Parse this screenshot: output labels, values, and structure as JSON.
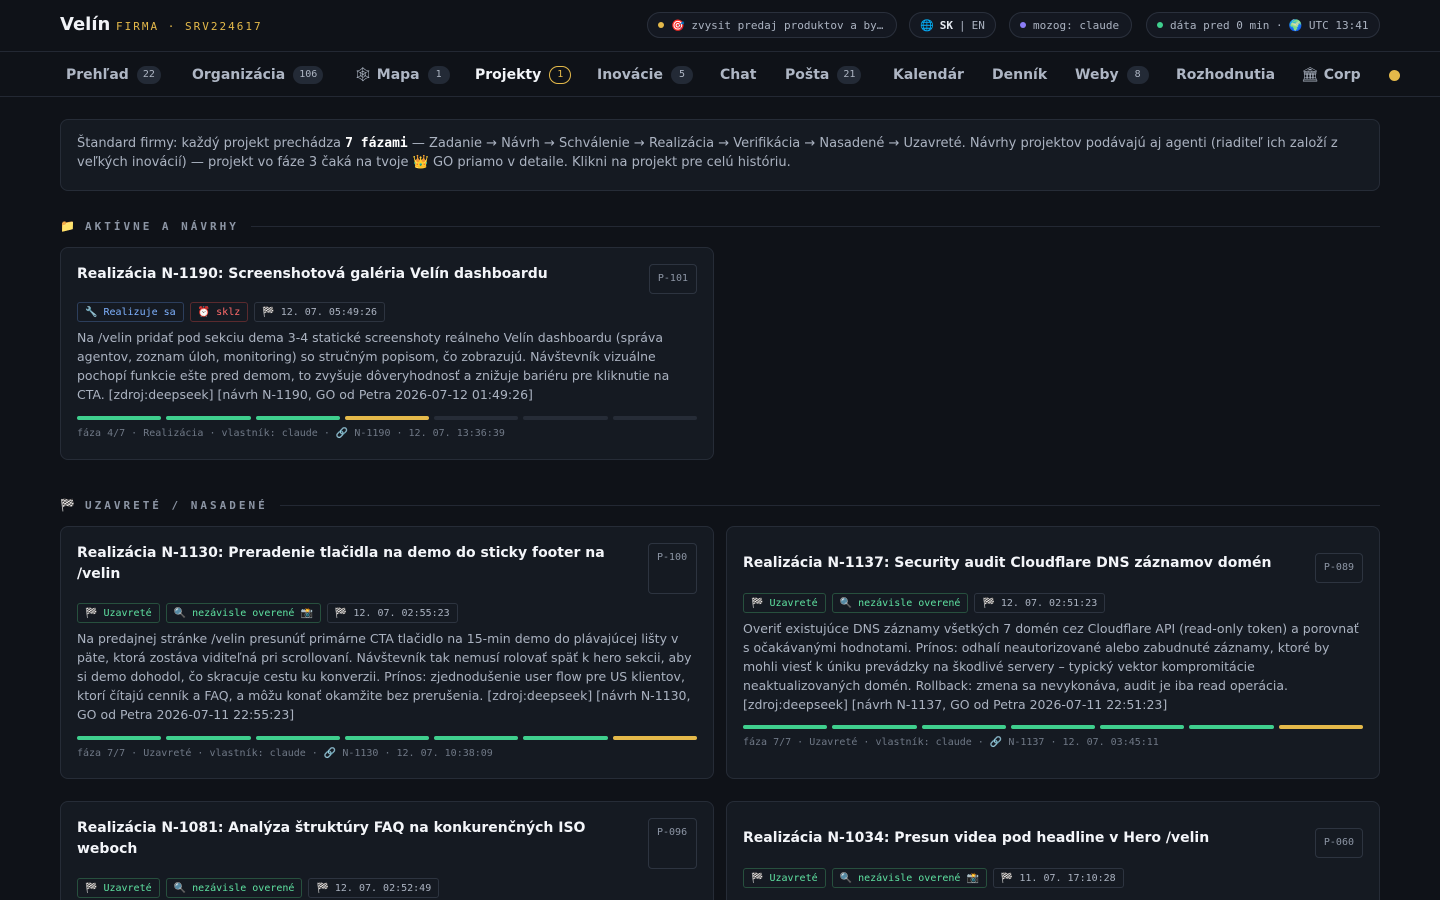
{
  "header": {
    "brand": "Velín",
    "brand_sub": "FIRMA · SRV224617",
    "goal": "🎯 zvysit predaj produktov a by…",
    "lang_sk": "SK",
    "lang_sep": "|",
    "lang_en": "EN",
    "brain": "mozog: claude",
    "data_age": "dáta pred 0 min ·",
    "utc": "🌍 UTC 13:41",
    "colors": {
      "accent": "#e4b94a",
      "ok": "#3fcf8e",
      "brain": "#8b7cf6"
    }
  },
  "tabs": [
    {
      "label": "Prehľad",
      "badge": "22"
    },
    {
      "label": "Organizácia",
      "badge": "106"
    },
    {
      "icon": "🕸",
      "label": "Mapa",
      "badge": "1"
    },
    {
      "label": "Projekty",
      "badge": "1",
      "active": true
    },
    {
      "label": "Inovácie",
      "badge": "5"
    },
    {
      "label": "Chat"
    },
    {
      "label": "Pošta",
      "badge": "21"
    },
    {
      "label": "Kalendár"
    },
    {
      "label": "Denník"
    },
    {
      "label": "Weby",
      "badge": "8"
    },
    {
      "label": "Rozhodnutia"
    },
    {
      "icon": "🏛",
      "label": "Corp"
    }
  ],
  "info": {
    "before": "Štandard firmy: každý projekt prechádza ",
    "phases": "7 fázami",
    "after": " — Zadanie → Návrh → Schválenie → Realizácia → Verifikácia → Nasadené → Uzavreté. Návrhy projektov podávajú aj agenti (riaditeľ ich založí z veľkých inovácií) — projekt vo fáze 3 čaká na tvoje 👑 GO priamo v detaile. Klikni na projekt pre celú históriu."
  },
  "sections": {
    "active": {
      "icon": "📁",
      "title": "AKTÍVNE A NÁVRHY"
    },
    "closed": {
      "icon": "🏁",
      "title": "UZAVRETÉ / NASADENÉ"
    }
  },
  "projects": [
    {
      "title": "Realizácia N-1190: Screenshotová galéria Velín dashboardu",
      "pid": "P-101",
      "tags": [
        {
          "icon": "🔧",
          "text": "Realizuje sa"
        },
        {
          "icon": "⏰",
          "text": "sklz"
        },
        {
          "icon": "🏁",
          "text": "12. 07. 05:49:26"
        }
      ],
      "desc": "Na /velin pridať pod sekciu dema 3-4 statické screenshoty reálneho Velín dashboardu (správa agentov, zoznam úloh, monitoring) so stručným popisom, čo zobrazujú. Návštevník vizuálne pochopí funkcie ešte pred demom, to zvyšuje dôveryhodnosť a znižuje bariéru pre kliknutie na CTA. [zdroj:deepseek] [návrh N-1190, GO od Petra 2026-07-12 01:49:26]",
      "phase_done": 3,
      "phase_total": 7,
      "meta": "fáza 4/7 · Realizácia · vlastník: claude · 🔗 N-1190 · 12. 07. 13:36:39"
    },
    {
      "title": "Realizácia N-1130: Preradenie tlačidla na demo do sticky footer na /velin",
      "pid": "P-100",
      "tags": [
        {
          "icon": "🏁",
          "text": "Uzavreté"
        },
        {
          "icon": "🔍",
          "text": "nezávisle overené 📸"
        },
        {
          "icon": "🏁",
          "text": "12. 07. 02:55:23"
        }
      ],
      "desc": "Na predajnej stránke /velin presunúť primárne CTA tlačidlo na 15-min demo do plávajúcej lišty v päte, ktorá zostáva viditeľná pri scrollovaní. Návštevník tak nemusí rolovať späť k hero sekcii, aby si demo dohodol, čo skracuje cestu ku konverzii. Prínos: zjednodušenie user flow pre US klientov, ktorí čítajú cenník a FAQ, a môžu konať okamžite bez prerušenia. [zdroj:deepseek] [návrh N-1130, GO od Petra 2026-07-11 22:55:23]",
      "phase_done": 6,
      "phase_total": 7,
      "meta": "fáza 7/7 · Uzavreté · vlastník: claude · 🔗 N-1130 · 12. 07. 10:38:09"
    },
    {
      "title": "Realizácia N-1137: Security audit Cloudflare DNS záznamov domén",
      "pid": "P-089",
      "tags": [
        {
          "icon": "🏁",
          "text": "Uzavreté"
        },
        {
          "icon": "🔍",
          "text": "nezávisle overené"
        },
        {
          "icon": "🏁",
          "text": "12. 07. 02:51:23"
        }
      ],
      "desc": "Overiť existujúce DNS záznamy všetkých 7 domén cez Cloudflare API (read-only token) a porovnať s očakávanými hodnotami. Prínos: odhalí neautorizované alebo zabudnuté záznamy, ktoré by mohli viesť k úniku prevádzky na škodlivé servery – typický vektor kompromitácie neaktualizovaných domén. Rollback: zmena sa nevykonáva, audit je iba read operácia. [zdroj:deepseek] [návrh N-1137, GO od Petra 2026-07-11 22:51:23]",
      "phase_done": 6,
      "phase_total": 7,
      "meta": "fáza 7/7 · Uzavreté · vlastník: claude · 🔗 N-1137 · 12. 07. 03:45:11"
    },
    {
      "title": "Realizácia N-1081: Analýza štruktúry FAQ na konkurenčných ISO weboch",
      "pid": "P-096",
      "tags": [
        {
          "icon": "🏁",
          "text": "Uzavreté"
        },
        {
          "icon": "🔍",
          "text": "nezávisle overené"
        },
        {
          "icon": "🏁",
          "text": "12. 07. 02:52:49"
        }
      ]
    },
    {
      "title": "Realizácia N-1034: Presun videa pod headline v Hero /velin",
      "pid": "P-060",
      "tags": [
        {
          "icon": "🏁",
          "text": "Uzavreté"
        },
        {
          "icon": "🔍",
          "text": "nezávisle overené 📸"
        },
        {
          "icon": "🏁",
          "text": "11. 07. 17:10:28"
        }
      ]
    }
  ]
}
